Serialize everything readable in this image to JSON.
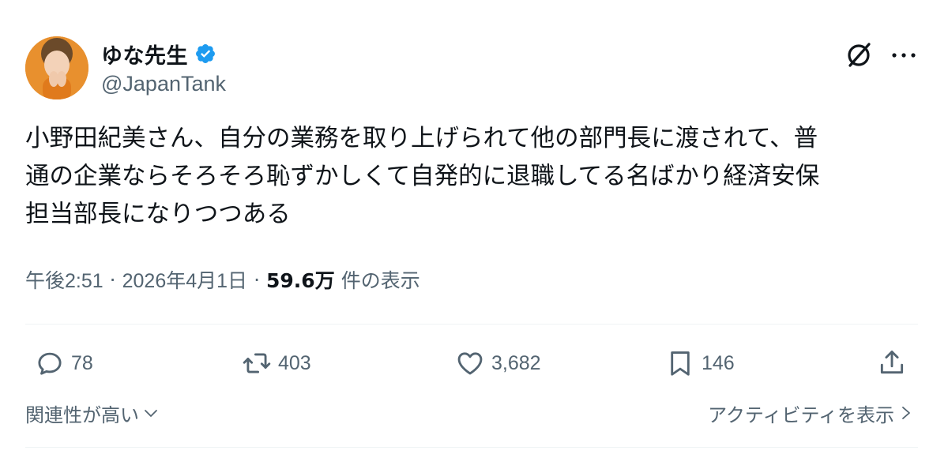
{
  "author": {
    "display_name": "ゆな先生",
    "handle": "@JapanTank",
    "verified": true,
    "accent_color": "#1d9bf0"
  },
  "header_icons": {
    "grok": "grok-icon",
    "more": "more-icon"
  },
  "tweet": {
    "text": "小野田紀美さん、自分の業務を取り上げられて他の部門長に渡されて、普\n通の企業ならそろそろ恥ずかしくて自発的に退職してる名ばかり経済安保\n担当部長になりつつある"
  },
  "meta": {
    "time": "午後2:51",
    "separator": "·",
    "date": "2026年4月1日",
    "views_count": "59.6万",
    "views_label": "件の表示"
  },
  "actions": {
    "replies": "78",
    "reposts": "403",
    "likes": "3,682",
    "bookmarks": "146"
  },
  "footer": {
    "sort_label": "関連性が高い",
    "activity_label": "アクティビティを表示"
  }
}
